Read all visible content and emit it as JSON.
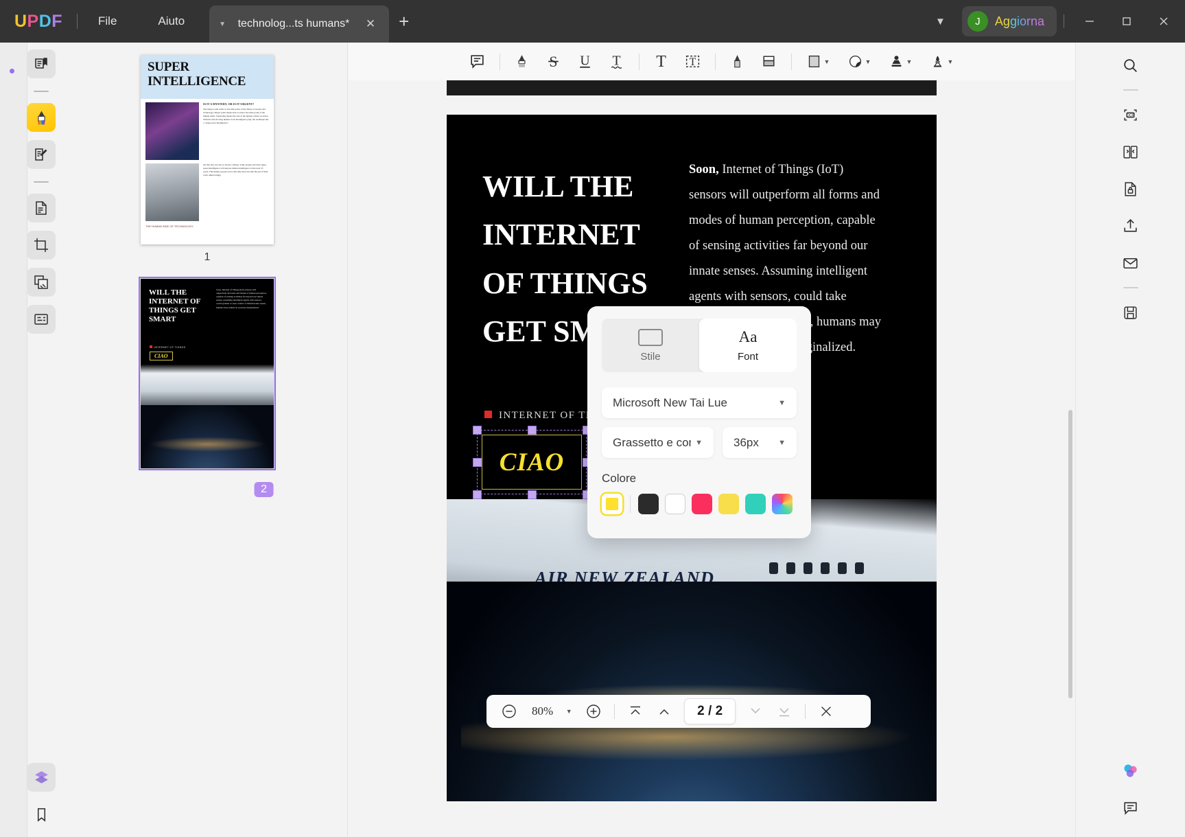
{
  "titlebar": {
    "logo": "UPDF",
    "menus": [
      "File",
      "Aiuto"
    ],
    "tab_title": "technolog...ts humans*",
    "new_tab": "+",
    "upgrade_label": "Aggiorna",
    "avatar_initial": "J",
    "window_minimize": "—",
    "window_maximize": "☐",
    "window_close": "✕"
  },
  "left_rail": {
    "tools": [
      {
        "name": "reader-tool",
        "label": "Lettore"
      },
      {
        "name": "annotate-tool",
        "label": "Commenta",
        "active": true
      },
      {
        "name": "edit-pdf-tool",
        "label": "Modifica PDF"
      },
      {
        "name": "organize-pages-tool",
        "label": "Organizza pagine"
      },
      {
        "name": "crop-tool",
        "label": "Ritaglia"
      },
      {
        "name": "convert-tool",
        "label": "Converti"
      },
      {
        "name": "form-tool",
        "label": "Modulo"
      },
      {
        "name": "layers-tool",
        "label": "Livelli"
      },
      {
        "name": "bookmark-tool",
        "label": "Segnalibro"
      }
    ]
  },
  "thumbnails": {
    "pages": [
      {
        "number": "1",
        "selected": false,
        "title_line1": "SUPER",
        "title_line2": "INTELLIGENCE",
        "subtitle": "IS IT A MYSTERY, OR IS IT URGENT?",
        "body1": "The magic point refers to the time point of the future of people and technology. Magic point means that we know the time point of the human skills. Surprising means the end of the human values we know. With the fast-moving human work intelligence (AI), the technique has a \"super-level intelligence\".",
        "body2": "On this day one day is always coming. Some people alert that super-speed intelligence will surpass human intelligence in the next 25 years. This makes people worry that they may become the pet of their robot unknowingly.",
        "footer": "THE HUMAN SIDE OF TECHNOLOGY"
      },
      {
        "number": "2",
        "selected": true,
        "title": "WILL THE INTERNET OF THINGS GET SMART",
        "body": "Soon, Internet of Things (IoT) sensors will outperform all forms and modes of human perception, capable of sensing activities far beyond our innate senses. Assuming intelligent agents with sensors, could systems or ones control of infrastructure assets, humans may indeed be severely marginalized.",
        "iot_label": "INTERNET OF THINGS",
        "ciao": "CIAO"
      }
    ]
  },
  "toolbar": {
    "buttons": [
      {
        "name": "comment-icon",
        "label": "Nota"
      },
      {
        "name": "highlight-icon",
        "label": "Evidenzia"
      },
      {
        "name": "strikethrough-icon",
        "label": "Barrato"
      },
      {
        "name": "underline-icon",
        "label": "Sottolinea"
      },
      {
        "name": "squiggly-icon",
        "label": "Ondulato"
      },
      {
        "name": "text-icon",
        "label": "Testo"
      },
      {
        "name": "text-box-icon",
        "label": "Casella di testo"
      },
      {
        "name": "pencil-icon",
        "label": "Matita"
      },
      {
        "name": "eraser-icon",
        "label": "Gomma"
      },
      {
        "name": "shape-icon",
        "label": "Forma"
      },
      {
        "name": "sticky-note-icon",
        "label": "Nota adesiva"
      },
      {
        "name": "stamp-icon",
        "label": "Timbro"
      },
      {
        "name": "signature-icon",
        "label": "Firma"
      }
    ]
  },
  "right_rail": {
    "tools": [
      {
        "name": "search-icon",
        "label": "Cerca"
      },
      {
        "name": "ocr-icon",
        "label": "OCR"
      },
      {
        "name": "compare-icon",
        "label": "Confronta"
      },
      {
        "name": "protect-icon",
        "label": "Proteggi"
      },
      {
        "name": "share-icon",
        "label": "Condividi"
      },
      {
        "name": "email-icon",
        "label": "Email"
      },
      {
        "name": "save-cloud-icon",
        "label": "Salva"
      },
      {
        "name": "ai-assistant-icon",
        "label": "AI"
      },
      {
        "name": "comments-panel-icon",
        "label": "Commenti"
      }
    ]
  },
  "document": {
    "headline": "WILL THE INTERNET OF THINGS GET SMART",
    "body_lead": "Soon,",
    "body_text": " Internet of Things (IoT) sensors will outperform all forms and modes of human perception, capable of sensing activities far beyond our innate senses. Assuming intelligent agents with sensors, could take control of infrastructure, humans may indeed be severely marginalized.",
    "iot_label": "INTERNET OF THINGS",
    "selected_text": "CIAO",
    "plane_text": "AIR NEW ZEALAND"
  },
  "font_popup": {
    "tabs": [
      {
        "name": "stile",
        "label": "Stile",
        "active": false
      },
      {
        "name": "font",
        "label": "Font",
        "glyph": "Aa",
        "active": true
      }
    ],
    "font_family": "Microsoft New Tai Lue",
    "font_style": "Grassetto e corsivo",
    "font_size": "36px",
    "color_label": "Colore",
    "colors": [
      {
        "name": "yellow-selected",
        "hex": "#FFE02E",
        "selected": true
      },
      {
        "name": "black",
        "hex": "#2B2B2B",
        "selected": false
      },
      {
        "name": "white",
        "hex": "#FFFFFF",
        "selected": false
      },
      {
        "name": "crimson",
        "hex": "#FB2F5E",
        "selected": false
      },
      {
        "name": "yellow",
        "hex": "#F7DE4A",
        "selected": false
      },
      {
        "name": "teal",
        "hex": "#31D0BB",
        "selected": false
      },
      {
        "name": "rainbow",
        "hex": "rainbow",
        "selected": false
      }
    ]
  },
  "bottombar": {
    "zoom_out": "−",
    "zoom_value": "80%",
    "zoom_in": "+",
    "first_page": "first-page",
    "prev_page": "prev-page",
    "page_indicator": "2 / 2",
    "next_page": "next-page",
    "last_page": "last-page",
    "close": "✕"
  }
}
